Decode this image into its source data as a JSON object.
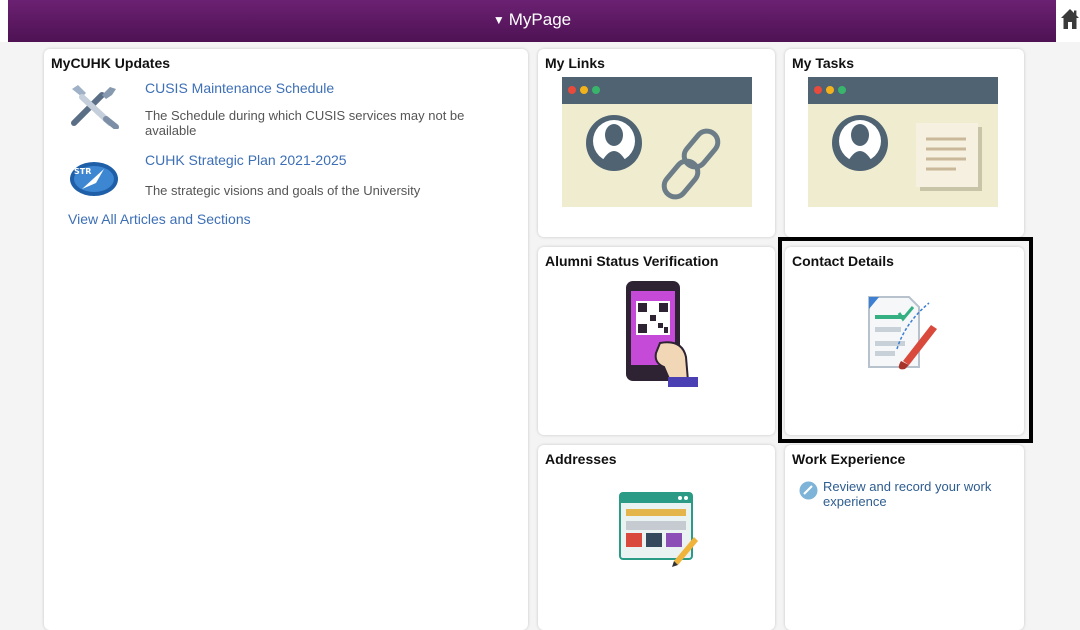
{
  "header": {
    "title": "MyPage",
    "colors": {
      "bar": "#5b1a61",
      "text": "#ffffff"
    }
  },
  "updates": {
    "title": "MyCUHK Updates",
    "items": [
      {
        "icon": "tools-icon",
        "link": "CUSIS Maintenance Schedule",
        "description": "The Schedule during which CUSIS services may not be available"
      },
      {
        "icon": "strategy-compass-icon",
        "link": "CUHK Strategic Plan 2021-2025",
        "description": "The strategic visions and goals of the University"
      }
    ],
    "view_all": "View All Articles and Sections"
  },
  "tiles": {
    "links": {
      "title": "My Links",
      "icon": "browser-person-chain-icon"
    },
    "tasks": {
      "title": "My Tasks",
      "icon": "browser-person-note-icon"
    },
    "alumni": {
      "title": "Alumni Status Verification",
      "icon": "phone-qr-code-icon"
    },
    "contact": {
      "title": "Contact Details",
      "icon": "document-pen-icon"
    },
    "addresses": {
      "title": "Addresses",
      "icon": "browser-form-icon"
    },
    "work": {
      "title": "Work Experience",
      "link": "Review and record your work experience",
      "icon": "briefcase-icon"
    }
  },
  "colors": {
    "link": "#3d6fb6",
    "highlight": "#000000"
  }
}
